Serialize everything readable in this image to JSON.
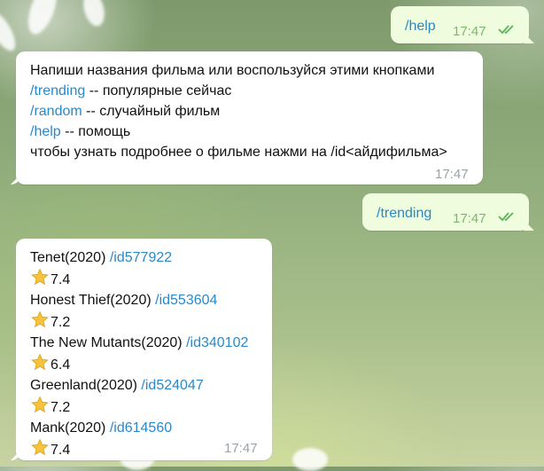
{
  "messages": {
    "help_cmd": {
      "text": "/help",
      "time": "17:47"
    },
    "bot_intro": {
      "line1": "Напиши названия фильма или воспользуйся этими кнопками",
      "trending_cmd": "/trending",
      "trending_desc": " -- популярные сейчас",
      "random_cmd": "/random",
      "random_desc": " -- случайный фильм",
      "help_cmd": "/help",
      "help_desc": " -- помощь",
      "line5": "чтобы узнать подробнее о фильме нажми на /id<айдифильма>",
      "time": "17:47"
    },
    "trending_cmd": {
      "text": "/trending",
      "time": "17:47"
    },
    "trending_list": {
      "time": "17:47",
      "items": [
        {
          "title": "Tenet(2020) ",
          "id": "/id577922",
          "rating": "7.4"
        },
        {
          "title": "Honest Thief(2020) ",
          "id": "/id553604",
          "rating": "7.2"
        },
        {
          "title": "The New Mutants(2020) ",
          "id": "/id340102",
          "rating": "6.4"
        },
        {
          "title": "Greenland(2020) ",
          "id": "/id524047",
          "rating": "7.2"
        },
        {
          "title": "Mank(2020) ",
          "id": "/id614560",
          "rating": "7.4"
        }
      ]
    }
  },
  "icons": {
    "star": "star-emoji",
    "ticks": "double-check"
  },
  "colors": {
    "link": "#2a88c9",
    "outgoing_bg": "#effdde",
    "read_ticks": "#5fb35a",
    "star": "#f6c33d"
  }
}
